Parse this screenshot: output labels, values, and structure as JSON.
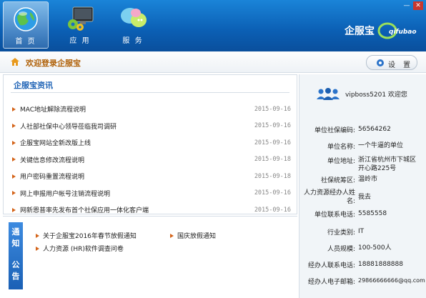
{
  "window": {
    "minimize_label": "—",
    "close_label": "✕"
  },
  "nav": [
    {
      "label": "首 页",
      "icon": "globe-icon",
      "active": true
    },
    {
      "label": "应 用",
      "icon": "monitor-gears-icon",
      "active": false
    },
    {
      "label": "服 务",
      "icon": "chat-bubbles-icon",
      "active": false
    }
  ],
  "brand": {
    "name": "企服宝",
    "logo_text": "qifubao"
  },
  "welcome": {
    "text": "欢迎登录企服宝",
    "settings_label": "设 置"
  },
  "news": {
    "title": "企服宝资讯",
    "items": [
      {
        "text": "MAC地址解除流程说明",
        "date": "2015-09-16"
      },
      {
        "text": "人社部社保中心领导莅临我司调研",
        "date": "2015-09-16"
      },
      {
        "text": "企服宝网站全新改版上线",
        "date": "2015-09-16"
      },
      {
        "text": "关键信息修改流程说明",
        "date": "2015-09-18"
      },
      {
        "text": "用户密码重置流程说明",
        "date": "2015-09-18"
      },
      {
        "text": "网上申报用户帐号注销流程说明",
        "date": "2015-09-16"
      },
      {
        "text": "网新恩普率先发布首个社保应用一体化客户端",
        "date": "2015-09-16"
      }
    ]
  },
  "notices": {
    "tag": [
      "通",
      "知",
      "公",
      "告"
    ],
    "items": [
      {
        "text": "关于企服宝2016年春节放假通知"
      },
      {
        "text": "国庆放假通知"
      },
      {
        "text": "人力资源 (HR)软件调查问卷"
      }
    ]
  },
  "user": {
    "greeting": "vipboss5201 欢迎您",
    "fields": [
      {
        "label": "单位社保编码:",
        "value": "56564262"
      },
      {
        "label": "单位名称:",
        "value": "一个牛逼的单位"
      },
      {
        "label": "单位地址:",
        "value": "浙江省杭州市下城区开心路225号"
      },
      {
        "label": "社保统筹区:",
        "value": "温岭市"
      },
      {
        "label": "人力资源经办人姓名:",
        "value": "我去"
      },
      {
        "label": "单位联系电话:",
        "value": "5585558"
      },
      {
        "label": "行业类别:",
        "value": "IT"
      },
      {
        "label": "人员规模:",
        "value": "100-500人"
      },
      {
        "label": "经办人联系电话:",
        "value": "18881888888"
      },
      {
        "label": "经办人电子邮箱:",
        "value": "29866666666@qq.com"
      }
    ]
  }
}
